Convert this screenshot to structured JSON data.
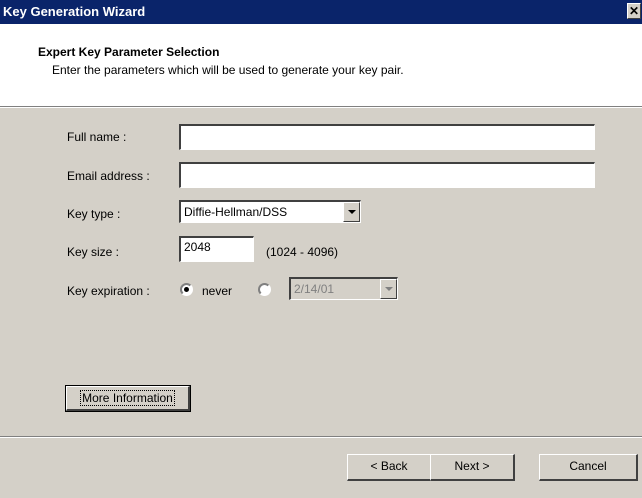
{
  "window": {
    "title": "Key Generation Wizard",
    "close_glyph": "✕"
  },
  "header": {
    "title": "Expert Key Parameter Selection",
    "subtitle": "Enter the parameters which will be used to generate your key pair."
  },
  "form": {
    "full_name": {
      "label": "Full name :",
      "value": ""
    },
    "email": {
      "label": "Email address :",
      "value": ""
    },
    "key_type": {
      "label": "Key type :",
      "selected": "Diffie-Hellman/DSS"
    },
    "key_size": {
      "label": "Key size :",
      "value": "2048",
      "range_hint": "(1024 - 4096)"
    },
    "expiration": {
      "label": "Key expiration :",
      "never_label": "never",
      "never_selected": true,
      "date_value": "2/14/01",
      "date_enabled": false
    }
  },
  "buttons": {
    "more_info": "More Information",
    "back": "< Back",
    "next": "Next >",
    "cancel": "Cancel"
  },
  "icons": {
    "close": "close-icon",
    "dropdown": "chevron-down-icon"
  }
}
